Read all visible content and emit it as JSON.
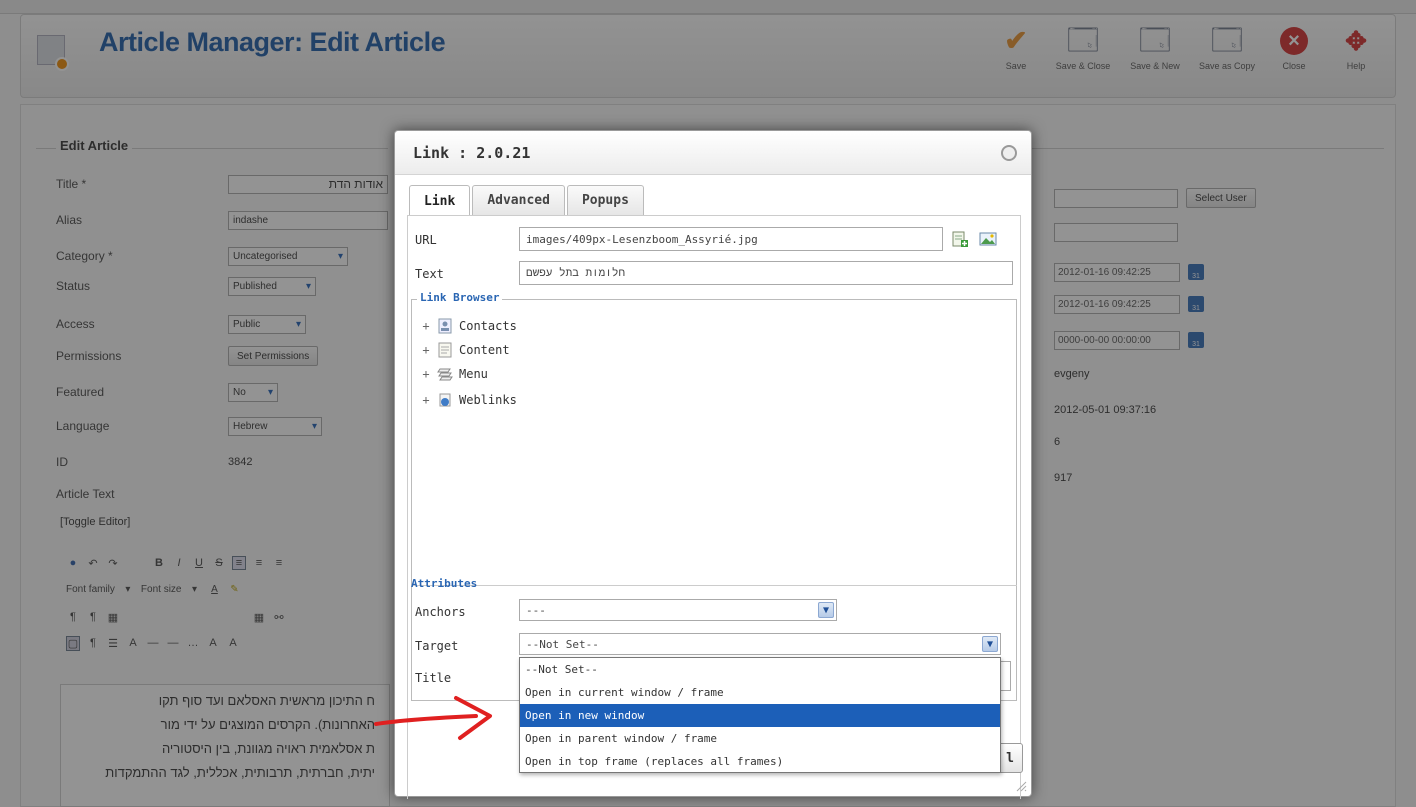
{
  "page": {
    "title": "Article Manager: Edit Article"
  },
  "toolbar": {
    "buttons": [
      {
        "label": "Save",
        "icon": "check-icon"
      },
      {
        "label": "Save & Close",
        "icon": "save-close-icon"
      },
      {
        "label": "Save & New",
        "icon": "save-new-icon"
      },
      {
        "label": "Save as Copy",
        "icon": "save-copy-icon"
      },
      {
        "label": "Close",
        "icon": "close-icon"
      },
      {
        "label": "Help",
        "icon": "help-icon"
      }
    ]
  },
  "form": {
    "legend": "Edit Article",
    "fields": [
      {
        "label": "Title *",
        "value": "אודות הדת"
      },
      {
        "label": "Alias",
        "value": "indashe"
      },
      {
        "label": "Category *",
        "value": "Uncategorised"
      },
      {
        "label": "Status",
        "value": "Published"
      },
      {
        "label": "Access",
        "value": "Public"
      },
      {
        "label": "Permissions",
        "value": "Set Permissions"
      },
      {
        "label": "Featured",
        "value": "No"
      },
      {
        "label": "Language",
        "value": "Hebrew"
      },
      {
        "label": "ID",
        "value": "3842"
      },
      {
        "label": "Article Text",
        "value": ""
      }
    ],
    "toggle_editor": "[Toggle Editor]",
    "editor_toolbar": {
      "font_family": "Font family",
      "font_size": "Font size"
    },
    "editor_lines": [
      "ח התיכון מראשית האסלאם ועד סוף תקו",
      "האחרונות). הקרסים המוצגים על ידי מור",
      "ת אסלאמית ראויה מגוונת, בין היסטוריה",
      "יתית, חברתית, תרבותית, אכללית, לגד ההתמקדות"
    ]
  },
  "right_panel": {
    "select_user": "Select User",
    "dates": [
      "2012-01-16 09:42:25",
      "2012-01-16 09:42:25",
      "0000-00-00 00:00:00"
    ],
    "author": "evgeny",
    "modified": "2012-05-01 09:37:16",
    "revision": "6",
    "hits": "917"
  },
  "modal": {
    "title": "Link : 2.0.21",
    "tabs": [
      "Link",
      "Advanced",
      "Popups"
    ],
    "url_label": "URL",
    "url_value": "images/409px-Lesenzboom_Assyrié.jpg",
    "text_label": "Text",
    "text_value": "חלומות בתל עפשם",
    "link_browser_legend": "Link Browser",
    "tree": [
      {
        "label": "Contacts",
        "icon": "contacts-icon"
      },
      {
        "label": "Content",
        "icon": "content-icon"
      },
      {
        "label": "Menu",
        "icon": "menu-icon"
      },
      {
        "label": "Weblinks",
        "icon": "weblinks-icon"
      }
    ],
    "attributes_legend": "Attributes",
    "anchors_label": "Anchors",
    "anchors_value": "---",
    "target_label": "Target",
    "target_value": "--Not Set--",
    "title_label": "Title",
    "target_options": [
      "--Not Set--",
      "Open in current window / frame",
      "Open in new window",
      "Open in parent window / frame",
      "Open in top frame (replaces all frames)"
    ],
    "highlighted_option": "Open in new window",
    "insert_button": "l"
  },
  "colors": {
    "title_blue": "#1b5aa6",
    "legend_blue": "#2a66b3",
    "highlight": "#1c5fb8",
    "arrow_red": "#e02020"
  }
}
